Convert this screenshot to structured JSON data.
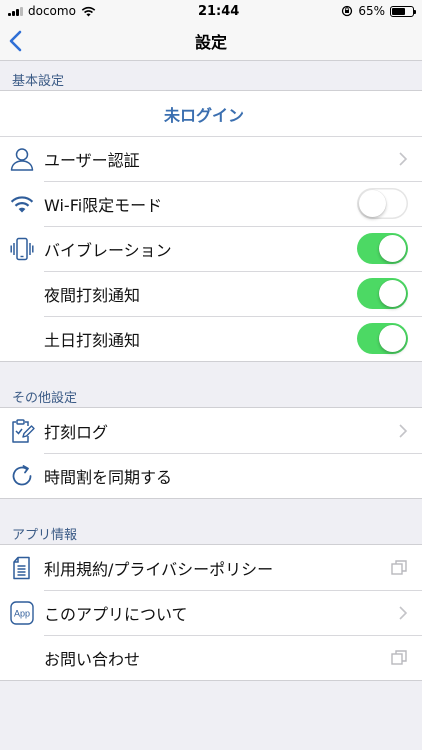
{
  "status_bar": {
    "carrier": "docomo",
    "time": "21:44",
    "battery_percent": "65%",
    "battery_level": 0.65
  },
  "nav": {
    "title": "設定",
    "back_icon": "chevron-left-icon"
  },
  "colors": {
    "accent": "#3b6fb0",
    "section_header": "#3b5b86",
    "toggle_on": "#4cd964",
    "background": "#efeff4"
  },
  "basic_settings": {
    "header": "基本設定",
    "login_status": "未ログイン",
    "items": [
      {
        "label": "ユーザー認証",
        "icon": "user-icon",
        "accessory": "chevron"
      },
      {
        "label": "Wi-Fi限定モード",
        "icon": "wifi-icon",
        "accessory": "toggle",
        "toggle_on": false
      },
      {
        "label": "バイブレーション",
        "icon": "vibration-icon",
        "accessory": "toggle",
        "toggle_on": true
      },
      {
        "label": "夜間打刻通知",
        "icon": "",
        "accessory": "toggle",
        "toggle_on": true
      },
      {
        "label": "土日打刻通知",
        "icon": "",
        "accessory": "toggle",
        "toggle_on": true
      }
    ]
  },
  "other_settings": {
    "header": "その他設定",
    "items": [
      {
        "label": "打刻ログ",
        "icon": "clipboard-edit-icon",
        "accessory": "chevron"
      },
      {
        "label": "時間割を同期する",
        "icon": "sync-icon",
        "accessory": "none"
      }
    ]
  },
  "app_info": {
    "header": "アプリ情報",
    "items": [
      {
        "label": "利用規約/プライバシーポリシー",
        "icon": "document-icon",
        "accessory": "external"
      },
      {
        "label": "このアプリについて",
        "icon": "app-icon",
        "icon_text": "App",
        "accessory": "chevron"
      },
      {
        "label": "お問い合わせ",
        "icon": "",
        "accessory": "external"
      }
    ]
  }
}
